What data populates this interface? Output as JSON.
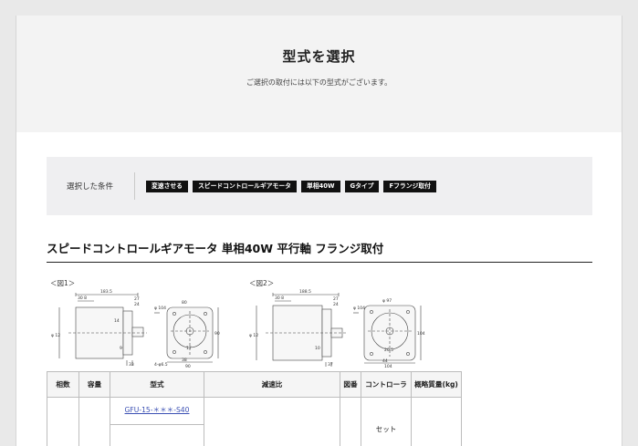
{
  "hero": {
    "title": "型式を選択",
    "subtitle": "ご選択の取付には以下の型式がございます。"
  },
  "conditions": {
    "label": "選択した条件",
    "tags": [
      "変速させる",
      "スピードコントロールギアモータ",
      "単相40W",
      "Gタイプ",
      "Fフランジ取付"
    ]
  },
  "section": {
    "title": "スピードコントロールギアモータ 単相40W 平行軸 フランジ取付"
  },
  "figures": {
    "fig1_label": "＜図1＞",
    "fig2_label": "＜図2＞",
    "fig1_dims": [
      "183.5",
      "30 8",
      "27",
      "24",
      "φ 12",
      "φ 104",
      "14",
      "9",
      "33",
      "4-φ6.5",
      "38",
      "90",
      "80",
      "φ 94",
      "17",
      "60"
    ],
    "fig2_dims": [
      "188.5",
      "30 8",
      "27",
      "24",
      "φ 12",
      "φ 104",
      "10",
      "14",
      "5",
      "37",
      "4-φ6.5",
      "44",
      "104",
      "98",
      "φ 97",
      "20.5",
      "80"
    ]
  },
  "table": {
    "headers": [
      "相数",
      "容量",
      "型式",
      "減速比",
      "図番",
      "コントローラ",
      "概略質量(kg)"
    ],
    "row": {
      "model": "GFU-15-＊＊＊-S40",
      "controller": "セット"
    }
  }
}
